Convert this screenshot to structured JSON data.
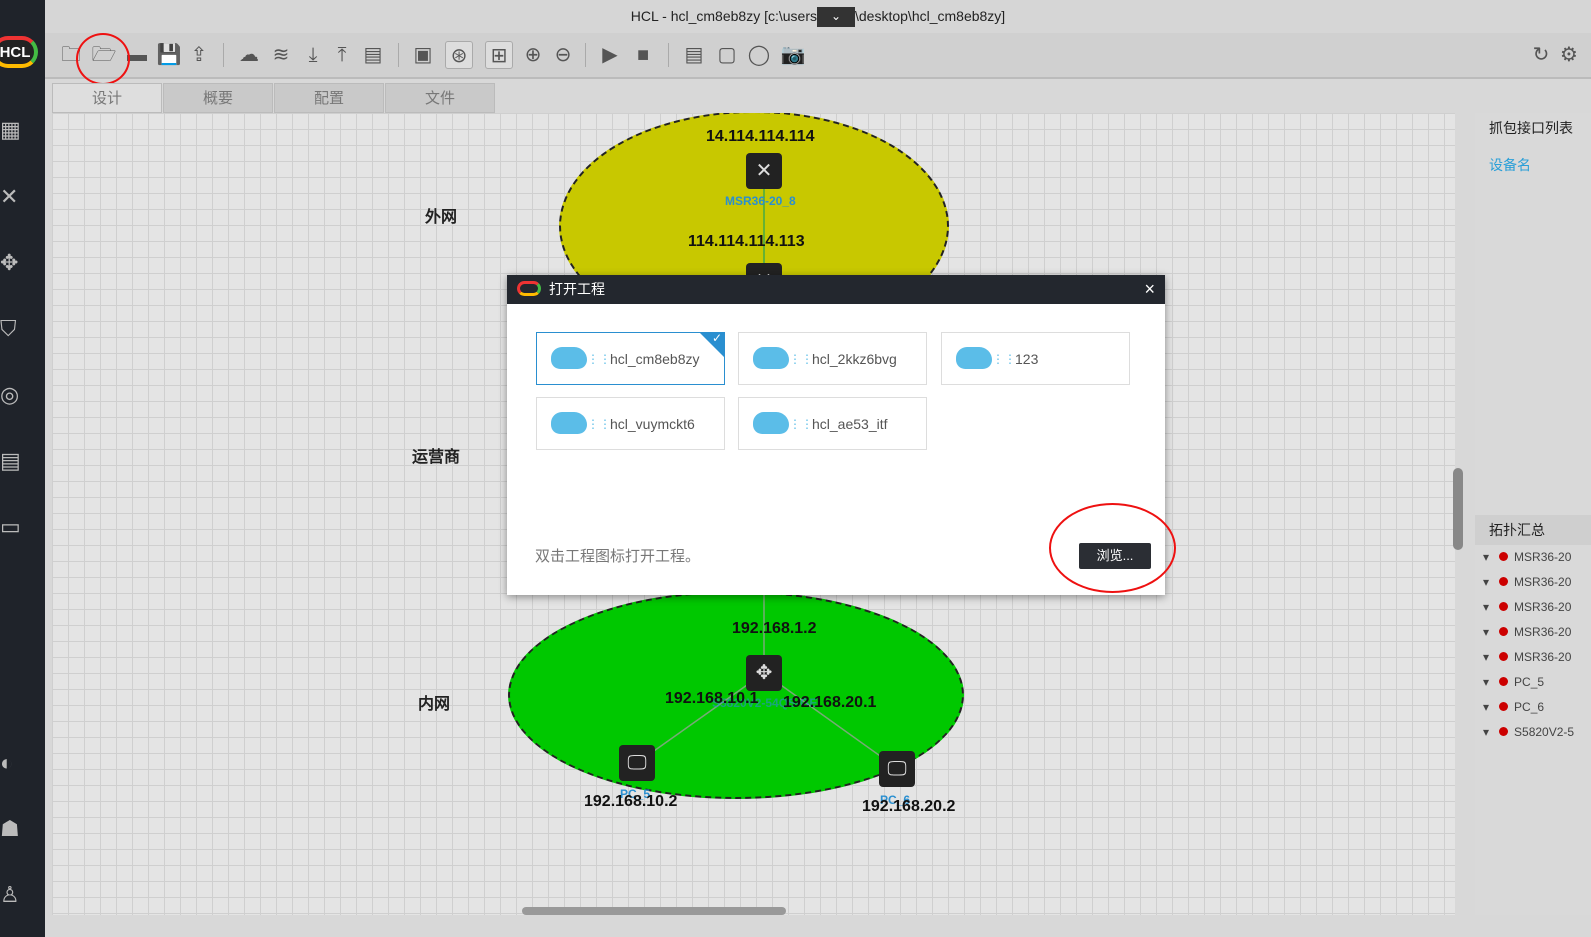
{
  "window": {
    "title_prefix": "HCL - hcl_cm8eb8zy [c:\\users",
    "title_suffix": "\\desktop\\hcl_cm8eb8zy]",
    "logo": "HCL"
  },
  "tabs": [
    {
      "label": "设计"
    },
    {
      "label": "概要"
    },
    {
      "label": "配置"
    },
    {
      "label": "文件"
    }
  ],
  "canvas": {
    "zones": {
      "outer": "外网",
      "isp": "运营商",
      "inner": "内网"
    },
    "ips": [
      "14.114.114.114",
      "114.114.114.113",
      "192.168.1.2",
      "192.168.10.1",
      "192.168.20.1",
      "192.168.10.2",
      "192.168.20.2"
    ],
    "devices": {
      "router": "MSR36-20_8",
      "switch": "S5820V2-54QS-GE",
      "pc5": "PC_5",
      "pc6": "PC_6"
    },
    "colors": {
      "outer": "#c8c800",
      "inner": "#00c800"
    }
  },
  "right_panel": {
    "capture_title": "抓包接口列表",
    "device_name": "设备名",
    "topology_title": "拓扑汇总",
    "items": [
      "MSR36-20",
      "MSR36-20",
      "MSR36-20",
      "MSR36-20",
      "MSR36-20",
      "PC_5",
      "PC_6",
      "S5820V2-5"
    ]
  },
  "dialog": {
    "title": "打开工程",
    "close": "×",
    "projects": [
      "hcl_cm8eb8zy",
      "hcl_2kkz6bvg",
      "123",
      "hcl_vuymckt6",
      "hcl_ae53_itf"
    ],
    "hint": "双击工程图标打开工程。",
    "browse": "浏览..."
  }
}
